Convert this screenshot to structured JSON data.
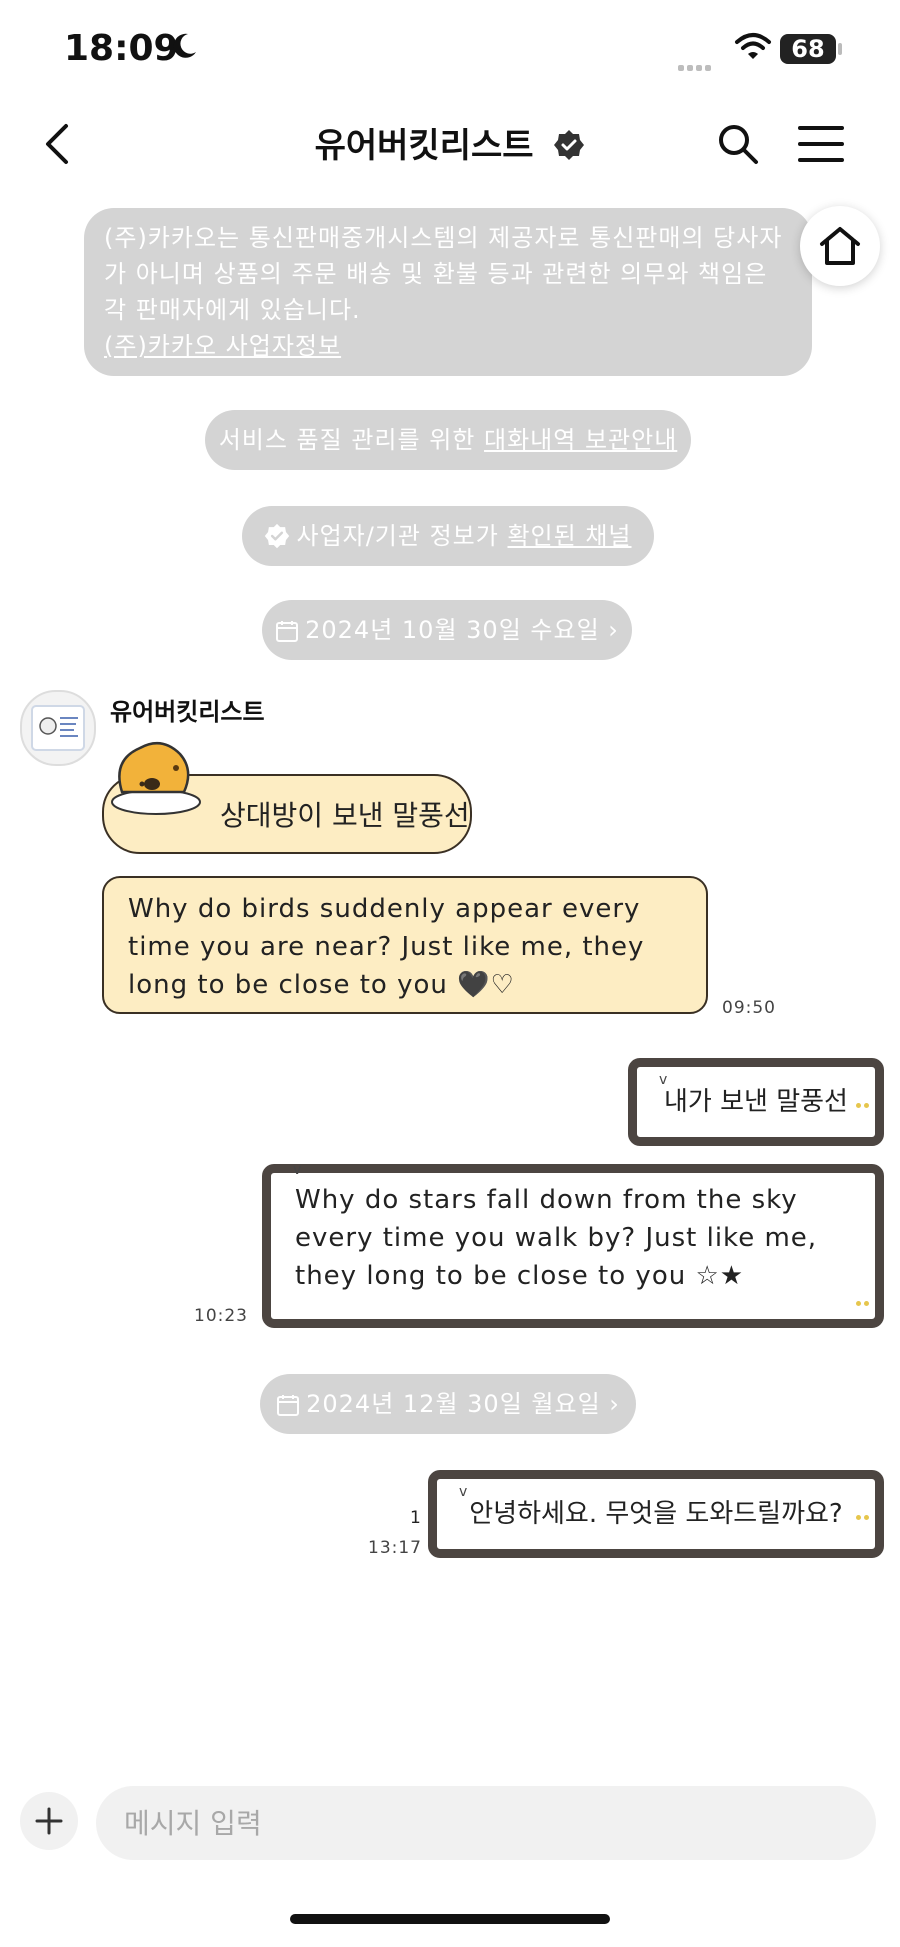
{
  "status_bar": {
    "time": "18:09",
    "battery": "68"
  },
  "header": {
    "title": "유어버킷리스트"
  },
  "notice": {
    "text": "(주)카카오는 통신판매중개시스템의 제공자로 통신판매의 당사자가 아니며 상품의 주문 배송 및 환불 등과 관련한 의무와 책임은 각 판매자에게 있습니다.",
    "link": "(주)카카오 사업자정보"
  },
  "service_pill": {
    "prefix": "서비스 품질 관리를 위한 ",
    "link": "대화내역 보관안내"
  },
  "verify_pill": {
    "prefix": "사업자/기관 정보가 ",
    "link": "확인된 채널"
  },
  "dates": [
    "2024년 10월 30일 수요일 ›",
    "2024년 12월 30일 월요일 ›"
  ],
  "received": {
    "sender": "유어버킷리스트",
    "bubble1": "상대방이 보낸 말풍선",
    "bubble2": "Why do birds suddenly appear every time you are near? Just like me, they long to be close to you 🖤♡",
    "time": "09:50"
  },
  "sent": {
    "bubble1": "내가 보낸 말풍선",
    "bubble2": "Why do stars fall down from the sky every time you walk by? Just like me, they long to be close to you ☆★",
    "time2": "10:23",
    "bubble3": "안녕하세요. 무엇을 도와드릴까요?",
    "unread": "1",
    "time3": "13:17"
  },
  "input": {
    "placeholder": "메시지 입력"
  }
}
